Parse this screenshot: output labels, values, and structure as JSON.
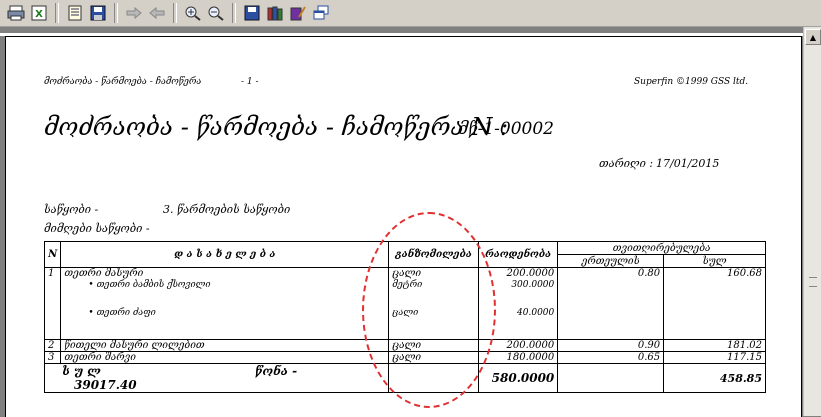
{
  "toolbar": {
    "icons": [
      "printer-icon",
      "excel-export-icon",
      "page-setup-icon",
      "save-icon",
      "forward-icon",
      "back-icon",
      "zoom-in-icon",
      "zoom-out-icon",
      "save-disk-icon",
      "books-icon",
      "book-edit-icon",
      "windows-icon"
    ]
  },
  "header": {
    "left_small": "მოძრაობა - წარმოება - ჩამოწერა",
    "page_no": "- 1 -",
    "right_small": "Superfin ©1999 GSS ltd."
  },
  "doc": {
    "title": "მოძრაობა - წარმოება - ჩამოწერა N :",
    "number": "მწ-1-00002",
    "date_label": "თარიღი :",
    "date_value": "17/01/2015",
    "warehouse_label": "საწყობი -",
    "warehouse_value": "3. წარმოების საწყობი",
    "dest_label": "მიმღები საწყობი -"
  },
  "table": {
    "headers": {
      "n": "N",
      "name": "დ ა ს ა ხ ე ლ ე ბ ა",
      "unit": "განზომილება",
      "qty": "რაოდენობა",
      "cost_group": "თვითღირებულება",
      "unit_cost": "ერთეულის",
      "total": "სულ"
    },
    "rows": [
      {
        "n": "1",
        "name": "თეთრი მასური",
        "unit": "ცალი",
        "qty": "200.0000",
        "unit_cost": "0.80",
        "total": "160.68",
        "sub": [
          {
            "name": "• თეთრი ბამბის ქსოვილი",
            "unit": "მეტრი",
            "qty": "300.0000"
          },
          {
            "name": "• თეთრი ძაფი",
            "unit": "ცალი",
            "qty": "40.0000"
          }
        ]
      },
      {
        "n": "2",
        "name": "წითელი მასური ლილებით",
        "unit": "ცალი",
        "qty": "200.0000",
        "unit_cost": "0.90",
        "total": "181.02"
      },
      {
        "n": "3",
        "name": "თეთრი შარვი",
        "unit": "ცალი",
        "qty": "180.0000",
        "unit_cost": "0.65",
        "total": "117.15"
      }
    ],
    "footer": {
      "label": "ს უ ლ",
      "weight_label": "წონა -",
      "weight_value": "39017.40",
      "qty_total": "580.0000",
      "total": "458.85"
    }
  },
  "colors": {
    "annotation": "#e03030",
    "toolbar_bg": "#d4d0c8"
  }
}
